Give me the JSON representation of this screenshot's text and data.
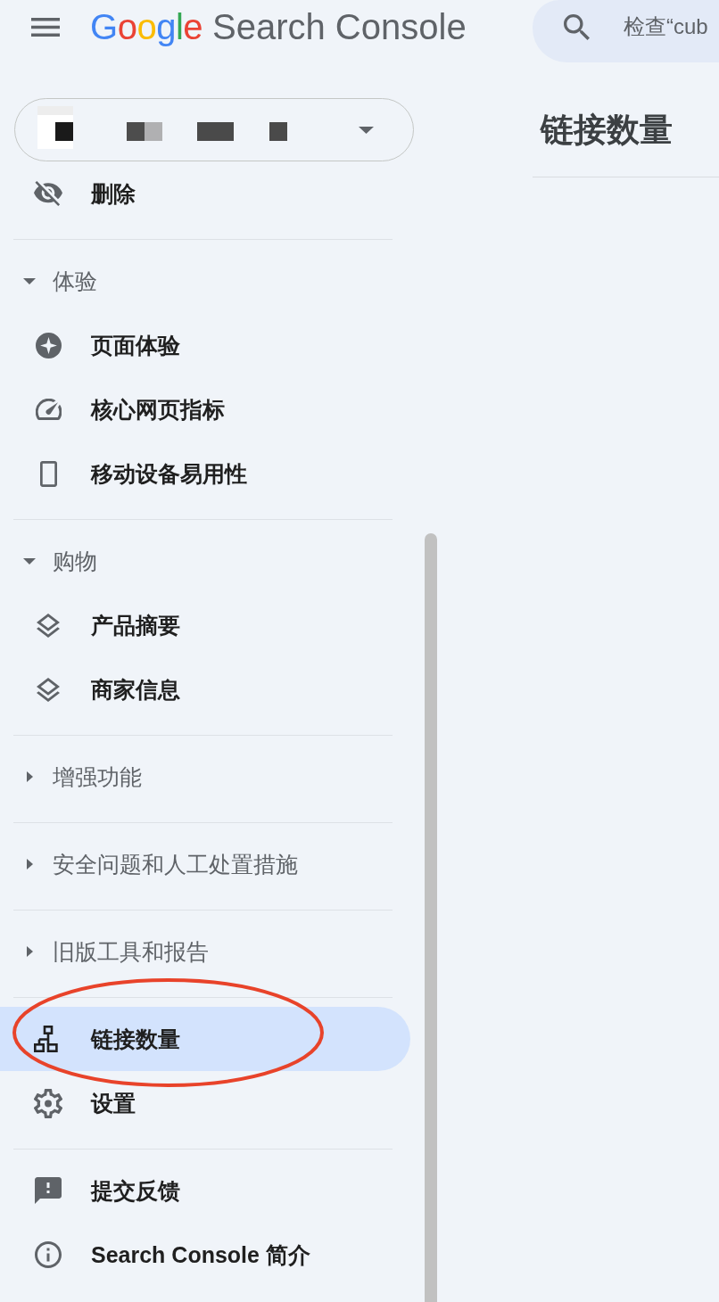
{
  "header": {
    "logo": "Google",
    "product": "Search Console",
    "search": {
      "placeholder": "检查“cub"
    }
  },
  "sidebar": {
    "groups": [
      {
        "items": [
          {
            "label": "删除",
            "selected": false
          }
        ]
      },
      {
        "heading": "体验",
        "expanded": true,
        "items": [
          {
            "label": "页面体验",
            "selected": false
          },
          {
            "label": "核心网页指标",
            "selected": false
          },
          {
            "label": "移动设备易用性",
            "selected": false
          }
        ]
      },
      {
        "heading": "购物",
        "expanded": true,
        "items": [
          {
            "label": "产品摘要",
            "selected": false
          },
          {
            "label": "商家信息",
            "selected": false
          }
        ]
      },
      {
        "heading": "增强功能",
        "expanded": false
      },
      {
        "heading": "安全问题和人工处置措施",
        "expanded": false
      },
      {
        "heading": "旧版工具和报告",
        "expanded": false
      },
      {
        "items": [
          {
            "label": "链接数量",
            "selected": true
          },
          {
            "label": "设置",
            "selected": false
          }
        ]
      },
      {
        "items": [
          {
            "label": "提交反馈",
            "selected": false
          },
          {
            "label": "Search Console 简介",
            "selected": false
          }
        ]
      }
    ]
  },
  "main": {
    "title": "链接数量"
  }
}
